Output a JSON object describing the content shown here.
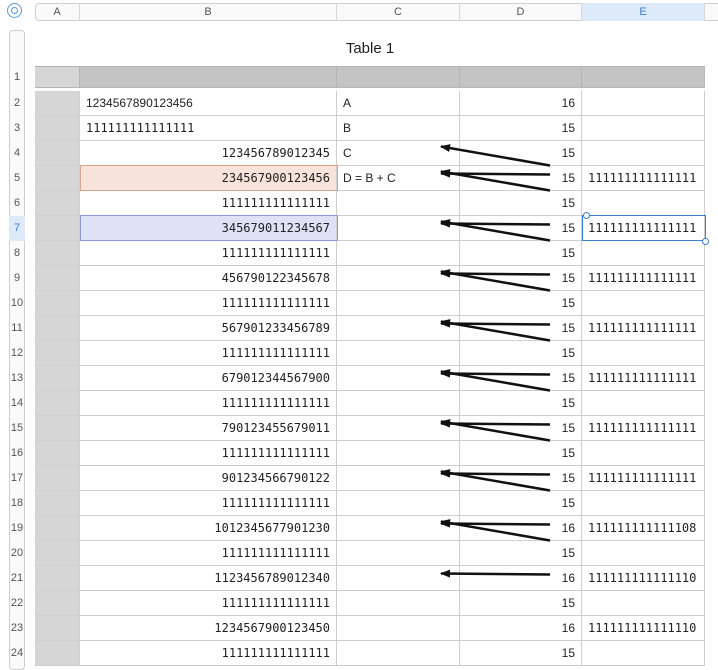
{
  "table_title": "Table 1",
  "columns": [
    "A",
    "B",
    "C",
    "D",
    "E"
  ],
  "selected_column": "E",
  "selected_row": "7",
  "rows": [
    {
      "n": "1",
      "b": "",
      "c": "",
      "d": "",
      "e": ""
    },
    {
      "n": "2",
      "b": "1234567890123456",
      "c": "A",
      "d": "16",
      "e": ""
    },
    {
      "n": "3",
      "b": "111111111111111",
      "c": "B",
      "d": "15",
      "e": ""
    },
    {
      "n": "4",
      "b": "123456789012345",
      "c": "C",
      "d": "15",
      "e": ""
    },
    {
      "n": "5",
      "b": "234567900123456",
      "c": "D = B + C",
      "d": "15",
      "e": "111111111111111"
    },
    {
      "n": "6",
      "b": "111111111111111",
      "c": "",
      "d": "15",
      "e": ""
    },
    {
      "n": "7",
      "b": "345679011234567",
      "c": "",
      "d": "15",
      "e": "111111111111111"
    },
    {
      "n": "8",
      "b": "111111111111111",
      "c": "",
      "d": "15",
      "e": ""
    },
    {
      "n": "9",
      "b": "456790122345678",
      "c": "",
      "d": "15",
      "e": "111111111111111"
    },
    {
      "n": "10",
      "b": "111111111111111",
      "c": "",
      "d": "15",
      "e": ""
    },
    {
      "n": "11",
      "b": "567901233456789",
      "c": "",
      "d": "15",
      "e": "111111111111111"
    },
    {
      "n": "12",
      "b": "111111111111111",
      "c": "",
      "d": "15",
      "e": ""
    },
    {
      "n": "13",
      "b": "679012344567900",
      "c": "",
      "d": "15",
      "e": "111111111111111"
    },
    {
      "n": "14",
      "b": "111111111111111",
      "c": "",
      "d": "15",
      "e": ""
    },
    {
      "n": "15",
      "b": "790123455679011",
      "c": "",
      "d": "15",
      "e": "111111111111111"
    },
    {
      "n": "16",
      "b": "111111111111111",
      "c": "",
      "d": "15",
      "e": ""
    },
    {
      "n": "17",
      "b": "901234566790122",
      "c": "",
      "d": "15",
      "e": "111111111111111"
    },
    {
      "n": "18",
      "b": "111111111111111",
      "c": "",
      "d": "15",
      "e": ""
    },
    {
      "n": "19",
      "b": "1012345677901230",
      "c": "",
      "d": "16",
      "e": "111111111111108"
    },
    {
      "n": "20",
      "b": "111111111111111",
      "c": "",
      "d": "15",
      "e": ""
    },
    {
      "n": "21",
      "b": "1123456789012340",
      "c": "",
      "d": "16",
      "e": "111111111111110"
    },
    {
      "n": "22",
      "b": "111111111111111",
      "c": "",
      "d": "15",
      "e": ""
    },
    {
      "n": "23",
      "b": "1234567900123450",
      "c": "",
      "d": "16",
      "e": "111111111111110"
    },
    {
      "n": "24",
      "b": "111111111111111",
      "c": "",
      "d": "15",
      "e": ""
    }
  ],
  "colors": {
    "selection": "#3b7fd0",
    "highlight_orange": "#f7e3d9",
    "highlight_blue": "#dde2f7",
    "header_fill": "#c4c4c4"
  }
}
